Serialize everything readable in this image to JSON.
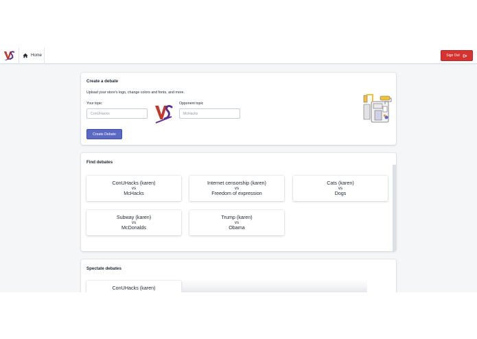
{
  "topbar": {
    "home_label": "Home",
    "signout_label": "Sign Out"
  },
  "create": {
    "title": "Create a debate",
    "description": "Upload your store's logo, change colors and fonts, and more.",
    "your_topic_label": "Your topic",
    "your_topic_placeholder": "ConUHacks",
    "opponent_topic_label": "Opponent topic",
    "opponent_topic_placeholder": "McHacks",
    "button_label": "Create Debate"
  },
  "find": {
    "title": "Find debates",
    "debates": [
      {
        "topic": "ConUHacks (karen)",
        "vs": "vs",
        "opponent": "McHacks"
      },
      {
        "topic": "Internet censorship (karen)",
        "vs": "vs",
        "opponent": "Freedom of expression"
      },
      {
        "topic": "Cats (karen)",
        "vs": "vs",
        "opponent": "Dogs"
      },
      {
        "topic": "Subway (karen)",
        "vs": "vs",
        "opponent": "McDonalds"
      },
      {
        "topic": "Trump (karen)",
        "vs": "vs",
        "opponent": "Obama"
      }
    ]
  },
  "spectate": {
    "title": "Spectate debates",
    "debates": [
      {
        "topic": "ConUHacks (karen)"
      }
    ]
  },
  "colors": {
    "primary": "#5c6ac4",
    "danger": "#d4332f",
    "background": "#f4f6f8"
  },
  "icons": [
    "vs-logo-icon",
    "home-icon",
    "sign-out-icon",
    "paint-roller-illustration"
  ]
}
